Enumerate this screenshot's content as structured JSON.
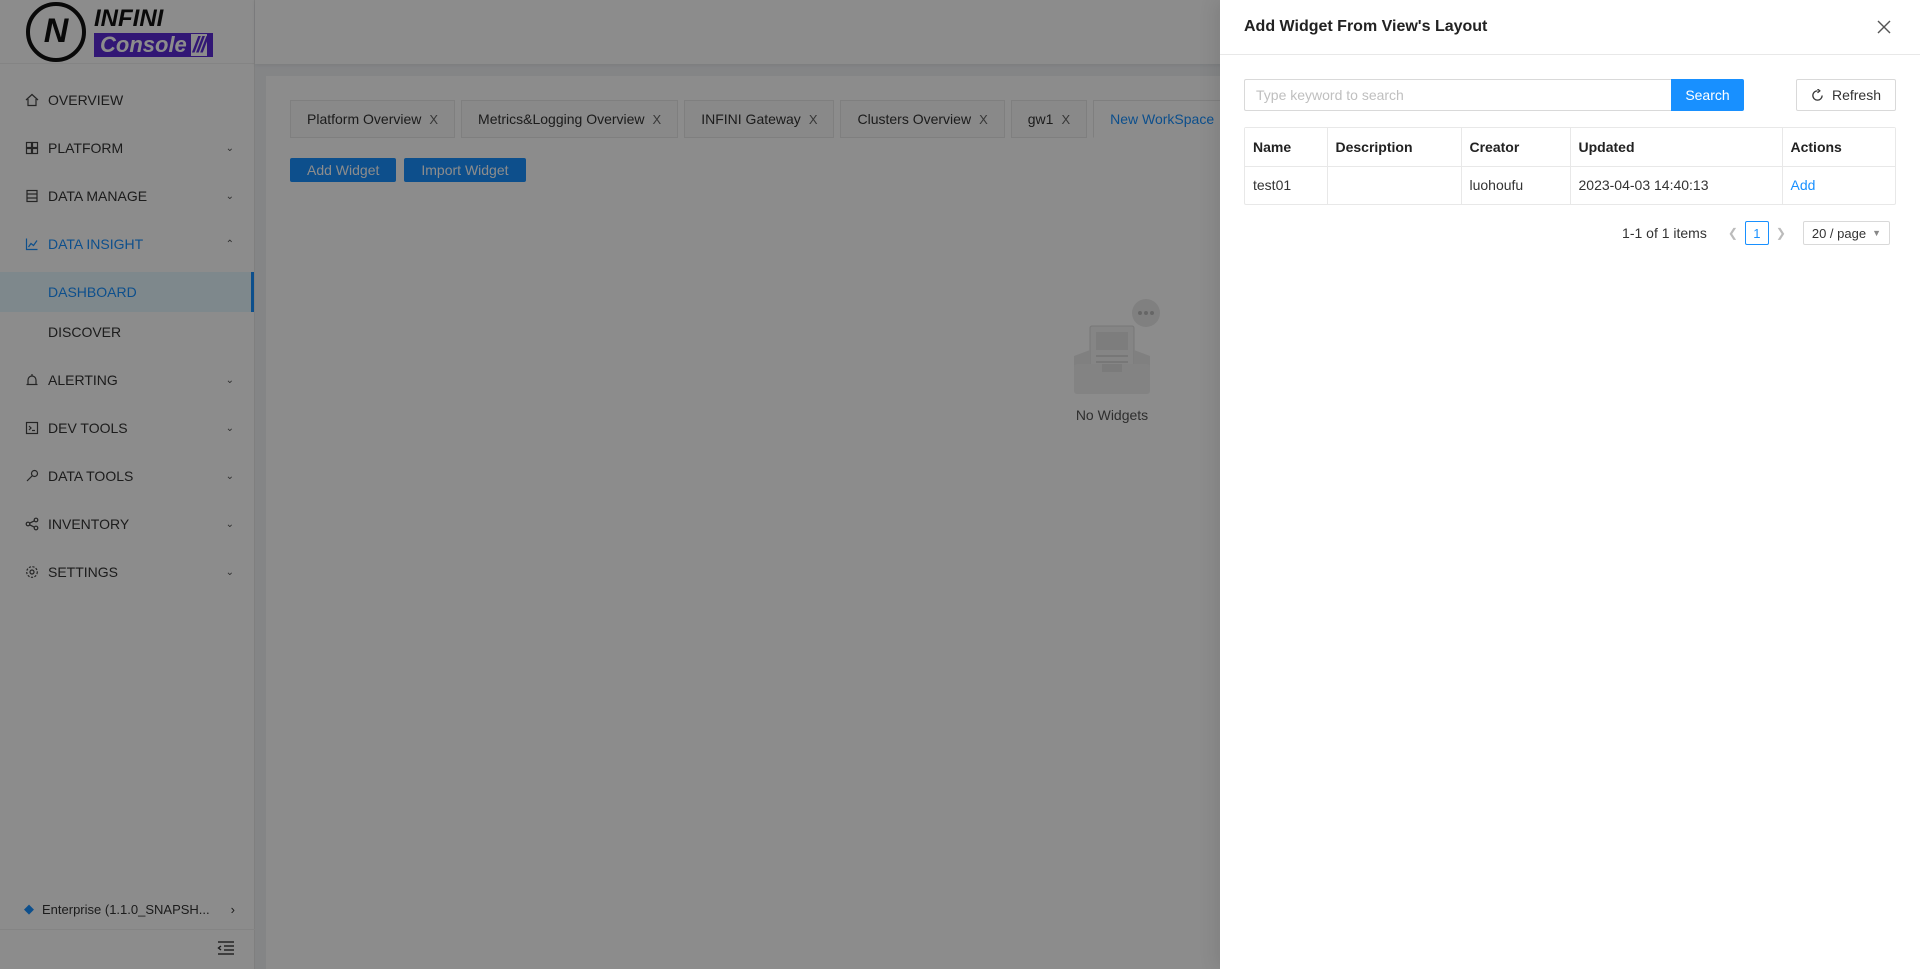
{
  "logo": {
    "letter": "N",
    "brand_top": "INFINI",
    "brand_bottom": "Console",
    "slashes": "///"
  },
  "sidebar": {
    "items": [
      {
        "label": "OVERVIEW",
        "icon": "home-icon"
      },
      {
        "label": "PLATFORM",
        "icon": "platform-icon"
      },
      {
        "label": "DATA MANAGE",
        "icon": "database-icon"
      },
      {
        "label": "DATA INSIGHT",
        "icon": "chart-icon"
      },
      {
        "label": "ALERTING",
        "icon": "alarm-icon"
      },
      {
        "label": "DEV TOOLS",
        "icon": "terminal-icon"
      },
      {
        "label": "DATA TOOLS",
        "icon": "tool-icon"
      },
      {
        "label": "INVENTORY",
        "icon": "share-icon"
      },
      {
        "label": "SETTINGS",
        "icon": "gear-icon"
      }
    ],
    "sub_items": [
      {
        "label": "DASHBOARD"
      },
      {
        "label": "DISCOVER"
      }
    ],
    "edition": "Enterprise (1.1.0_SNAPSH..."
  },
  "tabs": [
    {
      "label": "Platform Overview",
      "close": "X"
    },
    {
      "label": "Metrics&Logging Overview",
      "close": "X"
    },
    {
      "label": "INFINI Gateway",
      "close": "X"
    },
    {
      "label": "Clusters Overview",
      "close": "X"
    },
    {
      "label": "gw1",
      "close": "X"
    },
    {
      "label": "New WorkSpace"
    }
  ],
  "toolbar": {
    "add_widget": "Add Widget",
    "import_widget": "Import Widget"
  },
  "empty": {
    "label": "No Widgets"
  },
  "drawer": {
    "title": "Add Widget From View's Layout",
    "search_placeholder": "Type keyword to search",
    "search_label": "Search",
    "refresh_label": "Refresh",
    "columns": [
      "Name",
      "Description",
      "Creator",
      "Updated",
      "Actions"
    ],
    "rows": [
      {
        "name": "test01",
        "description": "",
        "creator": "luohoufu",
        "updated": "2023-04-03 14:40:13",
        "action": "Add"
      }
    ],
    "pagination": {
      "total": "1-1 of 1 items",
      "current": "1",
      "page_size": "20 / page"
    }
  },
  "colors": {
    "primary": "#1890ff",
    "brand": "#5b2bd6"
  }
}
